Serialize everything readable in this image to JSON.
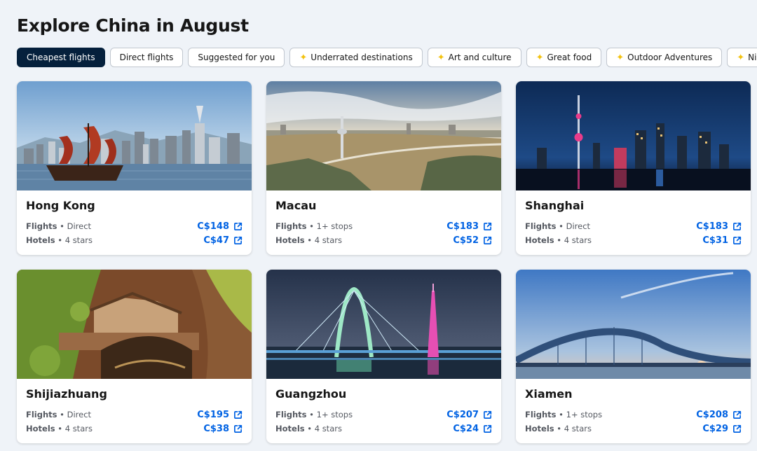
{
  "page": {
    "title": "Explore China in August"
  },
  "filters": [
    {
      "label": "Cheapest flights",
      "active": true,
      "icon": ""
    },
    {
      "label": "Direct flights",
      "active": false,
      "icon": ""
    },
    {
      "label": "Suggested for you",
      "active": false,
      "icon": ""
    },
    {
      "label": "Underrated destinations",
      "active": false,
      "icon": "sparkle-icon"
    },
    {
      "label": "Art and culture",
      "active": false,
      "icon": "sparkle-icon"
    },
    {
      "label": "Great food",
      "active": false,
      "icon": "sparkle-icon"
    },
    {
      "label": "Outdoor Adventures",
      "active": false,
      "icon": "sparkle-icon"
    },
    {
      "label": "Nightlife and e",
      "active": false,
      "icon": "sparkle-icon"
    }
  ],
  "labels": {
    "flights": "Flights",
    "hotels": "Hotels",
    "sep": " • "
  },
  "destinations": [
    {
      "city": "Hong Kong",
      "flights_detail": "Direct",
      "flights_price": "C$148",
      "hotels_detail": "4 stars",
      "hotels_price": "C$47"
    },
    {
      "city": "Macau",
      "flights_detail": "1+ stops",
      "flights_price": "C$183",
      "hotels_detail": "4 stars",
      "hotels_price": "C$52"
    },
    {
      "city": "Shanghai",
      "flights_detail": "Direct",
      "flights_price": "C$183",
      "hotels_detail": "4 stars",
      "hotels_price": "C$31"
    },
    {
      "city": "Shijiazhuang",
      "flights_detail": "Direct",
      "flights_price": "C$195",
      "hotels_detail": "4 stars",
      "hotels_price": "C$38"
    },
    {
      "city": "Guangzhou",
      "flights_detail": "1+ stops",
      "flights_price": "C$207",
      "hotels_detail": "4 stars",
      "hotels_price": "C$24"
    },
    {
      "city": "Xiamen",
      "flights_detail": "1+ stops",
      "flights_price": "C$208",
      "hotels_detail": "4 stars",
      "hotels_price": "C$29"
    }
  ],
  "colors": {
    "accent": "#0062e3",
    "chip_active": "#05203c",
    "background": "#eff3f8",
    "sparkle": "#f3c20e"
  },
  "icons": {
    "external_link": "external-link-icon",
    "sparkle": "sparkle-icon"
  }
}
